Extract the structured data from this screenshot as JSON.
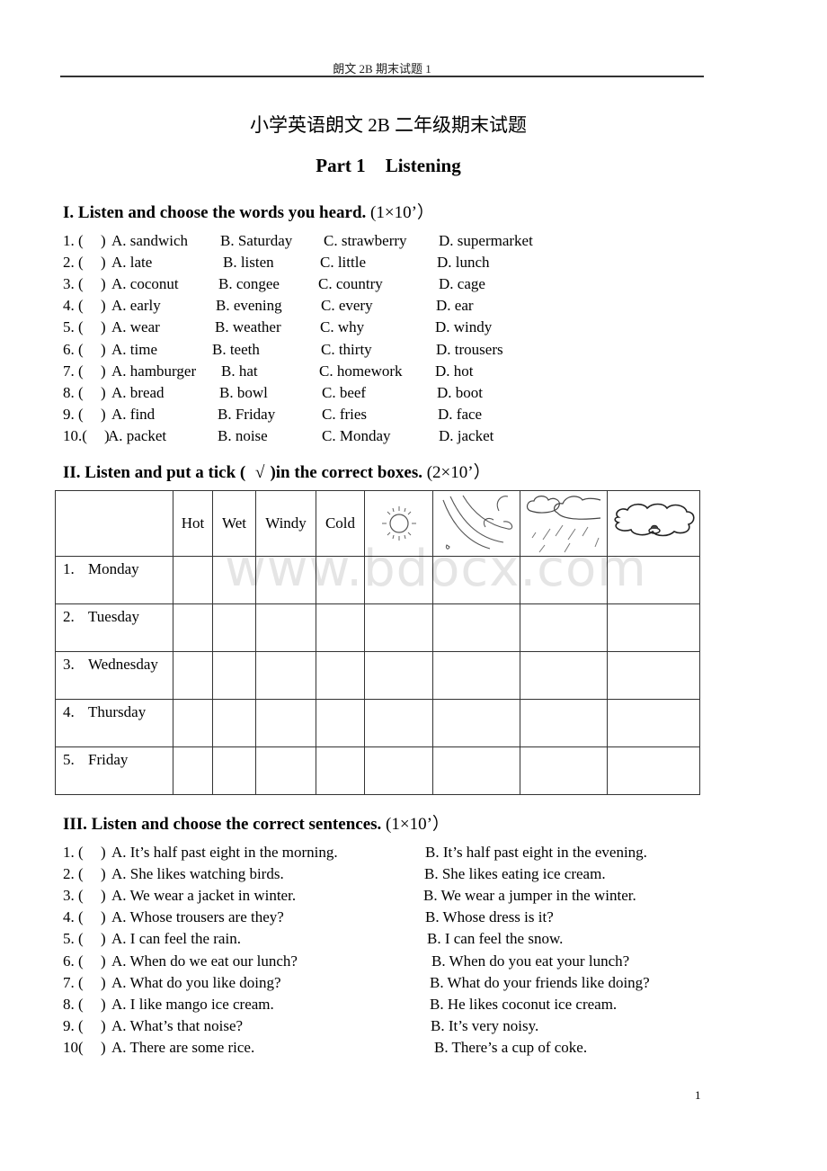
{
  "header": {
    "running_title": "朗文 2B 期末试题 1"
  },
  "title": "小学英语朗文 2B 二年级期末试题",
  "part": {
    "label": "Part 1",
    "name": "Listening"
  },
  "section1": {
    "heading": "I. Listen and choose the words you heard.",
    "points": "(1×10’）",
    "items": [
      {
        "num": "1. (",
        "close": ")",
        "a": "A. sandwich",
        "b": "B. Saturday",
        "c": "C. strawberry",
        "d": "D. supermarket"
      },
      {
        "num": "2. (",
        "close": ")",
        "a": "A. late",
        "b": "B. listen",
        "c": "C. little",
        "d": "D. lunch"
      },
      {
        "num": "3. (",
        "close": ")",
        "a": "A. coconut",
        "b": "B. congee",
        "c": "C. country",
        "d": "D. cage"
      },
      {
        "num": "4. (",
        "close": ")",
        "a": "A. early",
        "b": "B. evening",
        "c": "C. every",
        "d": "D. ear"
      },
      {
        "num": "5. (",
        "close": ")",
        "a": "A. wear",
        "b": "B. weather",
        "c": "C. why",
        "d": "D. windy"
      },
      {
        "num": "6. (",
        "close": ")",
        "a": "A. time",
        "b": "B. teeth",
        "c": "C. thirty",
        "d": "D. trousers"
      },
      {
        "num": "7. (",
        "close": ")",
        "a": "A. hamburger",
        "b": "B. hat",
        "c": "C. homework",
        "d": "D. hot"
      },
      {
        "num": "8. (",
        "close": ")",
        "a": "A. bread",
        "b": "B. bowl",
        "c": "C. beef",
        "d": "D. boot"
      },
      {
        "num": "9. (",
        "close": ")",
        "a": "A. find",
        "b": "B. Friday",
        "c": "C. fries",
        "d": "D. face"
      },
      {
        "num": "10.(",
        "close": ")",
        "a": "A. packet",
        "b": "B. noise",
        "c": "C. Monday",
        "d": "D. jacket"
      }
    ]
  },
  "section2": {
    "heading": "II. Listen and put a tick (",
    "tick": "√",
    "heading_end": ")in the correct boxes.",
    "points": "(2×10’）",
    "columns": [
      "Hot",
      "Wet",
      "Windy",
      "Cold"
    ],
    "picture_columns": [
      "sun-icon",
      "wind-icon",
      "rain-cloud-icon",
      "cloud-icon"
    ],
    "rows": [
      {
        "num": "1.",
        "day": "Monday"
      },
      {
        "num": "2.",
        "day": "Tuesday"
      },
      {
        "num": "3.",
        "day": "Wednesday"
      },
      {
        "num": "4.",
        "day": "Thursday"
      },
      {
        "num": "5.",
        "day": "Friday"
      }
    ]
  },
  "watermark": "www.bdocx.com",
  "section3": {
    "heading": "III. Listen and choose the correct sentences.",
    "points": "(1×10’）",
    "items": [
      {
        "num": "1. (",
        "close": ")",
        "a": "A. It’s half past eight in the morning.",
        "b": "B. It’s half past eight in the evening."
      },
      {
        "num": "2. (",
        "close": ")",
        "a": "A. She likes watching birds.",
        "b": "B. She likes eating ice cream."
      },
      {
        "num": "3. (",
        "close": ")",
        "a": "A. We wear a jacket in winter.",
        "b": "B. We wear a jumper in the winter."
      },
      {
        "num": "4. (",
        "close": ")",
        "a": "A. Whose trousers are they?",
        "b": "B. Whose dress is it?"
      },
      {
        "num": "5. (",
        "close": ")",
        "a": "A. I can feel the rain.",
        "b": "B. I can feel the snow."
      },
      {
        "num": "6. (",
        "close": ")",
        "a": "A. When do we eat our lunch?",
        "b": "B. When do you eat your lunch?"
      },
      {
        "num": "7. (",
        "close": ")",
        "a": "A. What do you like doing?",
        "b": "B. What do your friends like doing?"
      },
      {
        "num": "8. (",
        "close": ")",
        "a": "A. I like mango ice cream.",
        "b": "B. He likes coconut ice cream."
      },
      {
        "num": "9. (",
        "close": ")",
        "a": "A. What’s that noise?",
        "b": "B. It’s very noisy."
      },
      {
        "num": "10(",
        "close": ")",
        "a": "A. There are some rice.",
        "b": "B. There’s a cup of coke."
      }
    ]
  },
  "page_number": "1"
}
